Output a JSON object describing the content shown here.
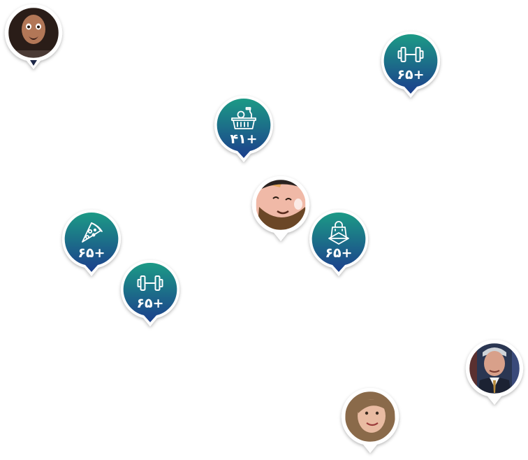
{
  "colors": {
    "gradient_top": "#1f9a86",
    "gradient_bottom": "#1b3f8c",
    "pin_border": "#ffffff",
    "icon_color": "#ffffff"
  },
  "category_pins": [
    {
      "id": "gym-1",
      "icon": "dumbbell-icon",
      "count": "۶۵+"
    },
    {
      "id": "grocery-1",
      "icon": "grocery-basket-icon",
      "count": "۴۱+"
    },
    {
      "id": "shopping-1",
      "icon": "shopping-bag-icon",
      "count": "۶۵+"
    },
    {
      "id": "pizza-1",
      "icon": "pizza-slice-icon",
      "count": "۶۵+"
    },
    {
      "id": "gym-2",
      "icon": "dumbbell-icon",
      "count": "۶۵+"
    }
  ],
  "avatar_pins": [
    {
      "id": "avatar-1",
      "icon": "user-avatar-icon"
    },
    {
      "id": "avatar-2",
      "icon": "user-avatar-icon"
    },
    {
      "id": "avatar-3",
      "icon": "user-avatar-icon"
    },
    {
      "id": "avatar-4",
      "icon": "user-avatar-icon"
    }
  ]
}
